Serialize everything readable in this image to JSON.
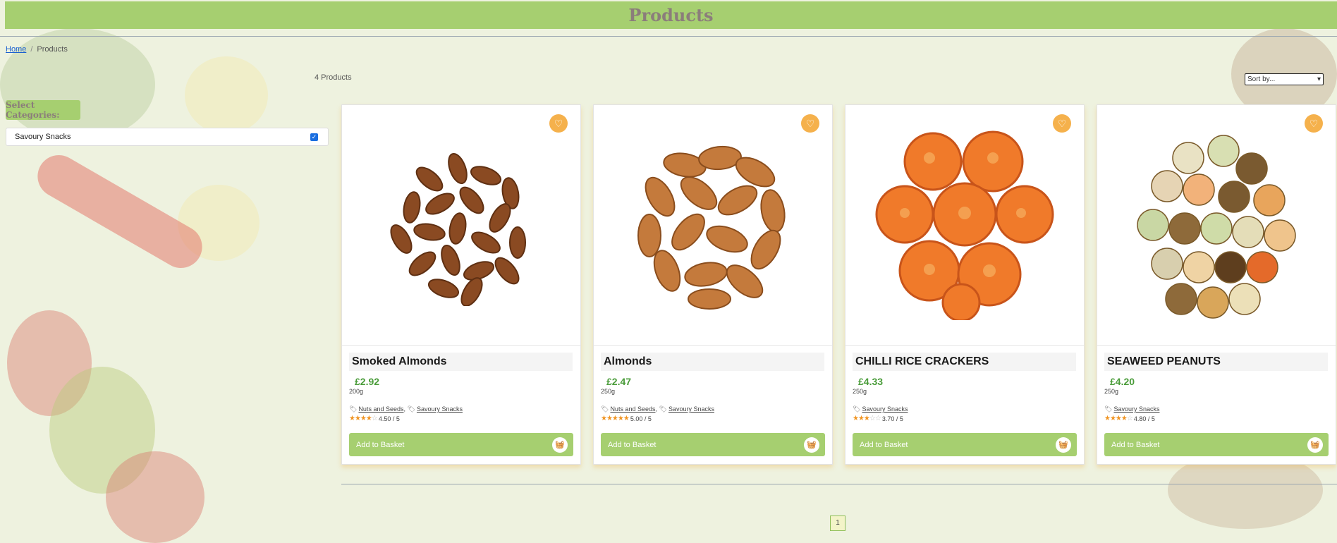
{
  "header": {
    "title": "Products"
  },
  "breadcrumb": {
    "home": "Home",
    "separator": "/",
    "current": "Products"
  },
  "sidebar": {
    "title": "Select Categories:",
    "categories": [
      {
        "label": "Savoury Snacks",
        "checked": true
      }
    ]
  },
  "toolbar": {
    "count": "4 Products",
    "sort_selected": "Sort by..."
  },
  "products": [
    {
      "name": "Smoked Almonds",
      "price": "£2.92",
      "weight": "200g",
      "tags": [
        "Nuts and Seeds",
        "Savoury Snacks"
      ],
      "rating": "4.50 / 5",
      "stars": 4.5,
      "basket_label": "Add to Basket"
    },
    {
      "name": "Almonds",
      "price": "£2.47",
      "weight": "250g",
      "tags": [
        "Nuts and Seeds",
        "Savoury Snacks"
      ],
      "rating": "5.00 / 5",
      "stars": 5,
      "basket_label": "Add to Basket"
    },
    {
      "name": "CHILLI RICE CRACKERS",
      "price": "£4.33",
      "weight": "250g",
      "tags": [
        "Savoury Snacks"
      ],
      "rating": "3.70 / 5",
      "stars": 3.7,
      "basket_label": "Add to Basket"
    },
    {
      "name": "SEAWEED PEANUTS",
      "price": "£4.20",
      "weight": "250g",
      "tags": [
        "Savoury Snacks"
      ],
      "rating": "4.80 / 5",
      "stars": 4.8,
      "basket_label": "Add to Basket"
    }
  ],
  "pagination": {
    "pages": [
      "1"
    ],
    "current": "1"
  },
  "colors": {
    "header_bg": "#a6cf70",
    "price": "#4a9c3a",
    "favourite": "#f5b14c",
    "star": "#f09422"
  }
}
